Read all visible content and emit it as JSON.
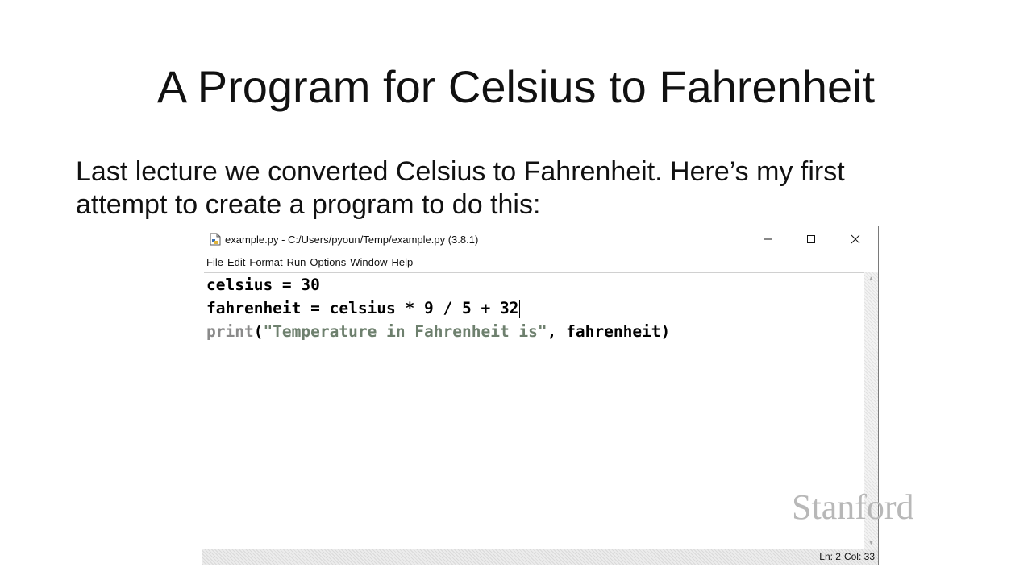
{
  "slide": {
    "title": "A Program for Celsius to Fahrenheit",
    "body_lines": [
      "Last lecture we converted Celsius to Fahrenheit.  Here’s my first",
      "attempt to create a program to do this:"
    ],
    "logo_text": "Stanford"
  },
  "window": {
    "icon": "python-file-icon",
    "title": "example.py - C:/Users/pyoun/Temp/example.py (3.8.1)",
    "controls": {
      "minimize": "—",
      "maximize": "☐",
      "close": "✕"
    }
  },
  "menu": [
    {
      "key": "F",
      "rest": "ile"
    },
    {
      "key": "E",
      "rest": "dit"
    },
    {
      "key": "F",
      "rest": "ormat"
    },
    {
      "key": "R",
      "rest": "un"
    },
    {
      "key": "O",
      "rest": "ptions"
    },
    {
      "key": "W",
      "rest": "indow"
    },
    {
      "key": "H",
      "rest": "elp"
    }
  ],
  "code": {
    "line1": "celsius = 30",
    "line2": "fahrenheit = celsius * 9 / 5 + 32",
    "line3": {
      "keyword": "print",
      "open": "(",
      "string": "\"Temperature in Fahrenheit is\"",
      "rest": ", fahrenheit)"
    }
  },
  "status": {
    "line": "Ln: 2",
    "col": "Col: 33"
  },
  "colors": {
    "builtin": "#8a8a8a",
    "string": "#6e806e",
    "logo": "#b8b8b8"
  }
}
